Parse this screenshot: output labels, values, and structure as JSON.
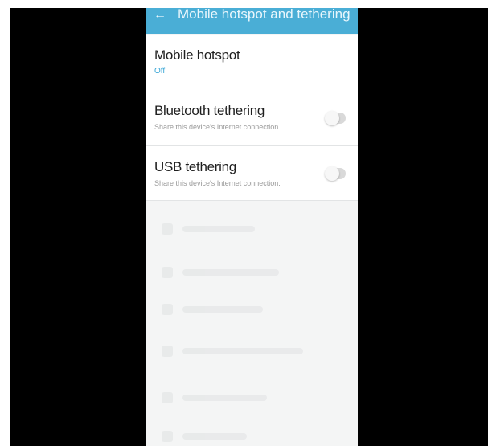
{
  "appbar": {
    "back_icon": "arrow-back-icon",
    "title": "Mobile hotspot and tethering",
    "background": "#4aaed6"
  },
  "rows": [
    {
      "title": "Mobile hotspot",
      "status": "Off"
    },
    {
      "title": "Bluetooth tethering",
      "subtitle": "Share this device's Internet connection.",
      "toggle": "off"
    },
    {
      "title": "USB tethering",
      "subtitle": "Share this device's Internet connection.",
      "toggle": "off"
    }
  ],
  "colors": {
    "accent": "#3aa6d6",
    "letterbox": "#000000"
  }
}
